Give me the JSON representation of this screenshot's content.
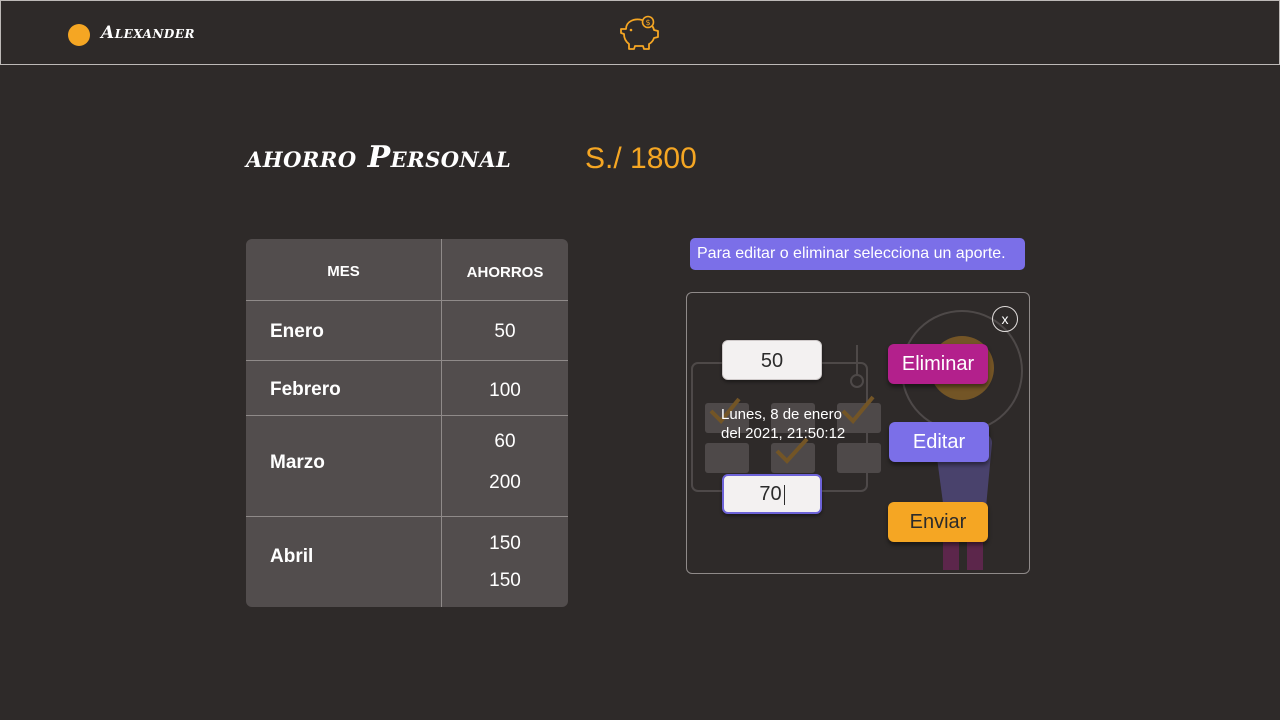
{
  "header": {
    "user_name": "Alexander",
    "logo_icon": "piggy-bank-icon",
    "accent": "#f5a623"
  },
  "main": {
    "title": "ahorro Personal",
    "total": "S./ 1800"
  },
  "table": {
    "headers": [
      "MES",
      "AHORROS"
    ],
    "rows": [
      {
        "month": "Enero",
        "amounts": [
          "50"
        ]
      },
      {
        "month": "Febrero",
        "amounts": [
          "100"
        ]
      },
      {
        "month": "Marzo",
        "amounts": [
          "60",
          "200"
        ]
      },
      {
        "month": "Abril",
        "amounts": [
          "150",
          "150"
        ]
      }
    ]
  },
  "hint": "Para editar o eliminar selecciona un aporte.",
  "panel": {
    "close_label": "x",
    "selected_amount": "50",
    "date_line1": "Lunes, 8 de enero",
    "date_line2": "del 2021, 21:50:12",
    "new_amount": "70",
    "delete_label": "Eliminar",
    "edit_label": "Editar",
    "send_label": "Enviar",
    "colors": {
      "delete": "#b3208c",
      "edit": "#7b6fe8",
      "send": "#f5a623"
    }
  }
}
